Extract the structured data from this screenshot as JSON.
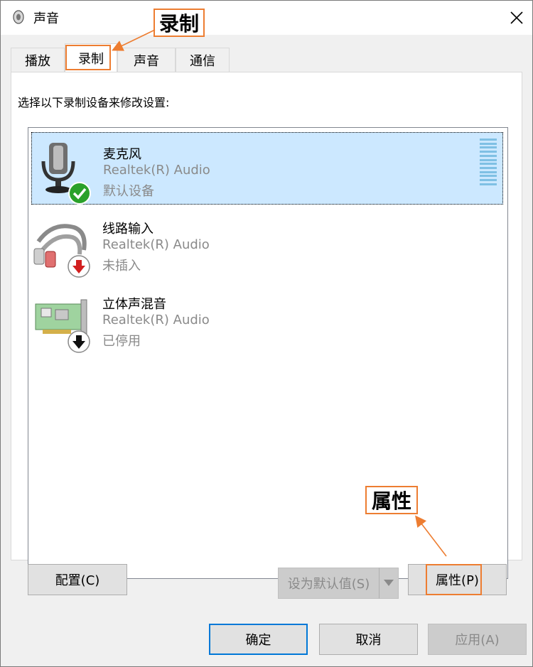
{
  "window": {
    "title": "声音"
  },
  "tabs": [
    {
      "label": "播放",
      "active": false
    },
    {
      "label": "录制",
      "active": true
    },
    {
      "label": "声音",
      "active": false
    },
    {
      "label": "通信",
      "active": false
    }
  ],
  "instruction": "选择以下录制设备来修改设置:",
  "devices": [
    {
      "name": "麦克风",
      "driver": "Realtek(R) Audio",
      "status": "默认设备",
      "selected": true,
      "icon": "microphone-icon",
      "badge": "check-icon"
    },
    {
      "name": "线路输入",
      "driver": "Realtek(R) Audio",
      "status": "未插入",
      "selected": false,
      "icon": "line-in-cable-icon",
      "badge": "red-down-arrow-icon"
    },
    {
      "name": "立体声混音",
      "driver": "Realtek(R) Audio",
      "status": "已停用",
      "selected": false,
      "icon": "sound-card-icon",
      "badge": "black-down-arrow-icon"
    }
  ],
  "buttons": {
    "configure": "配置(C)",
    "set_default": "设为默认值(S)",
    "properties": "属性(P)",
    "ok": "确定",
    "cancel": "取消",
    "apply": "应用(A)"
  },
  "annotations": {
    "record_callout": "录制",
    "properties_callout": "属性"
  },
  "colors": {
    "selection": "#cce8ff",
    "annotation": "#ed7d31",
    "primary_border": "#0078d7"
  }
}
